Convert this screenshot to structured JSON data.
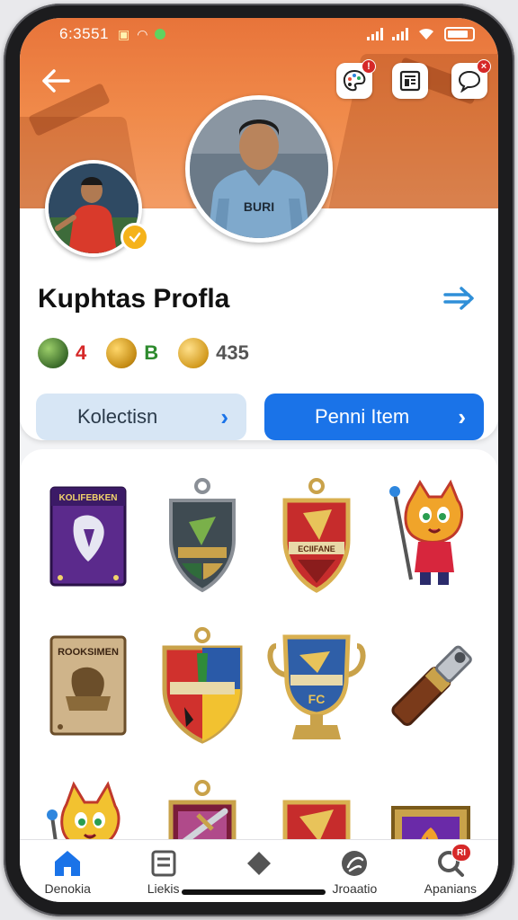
{
  "status_bar": {
    "time": "6:3551"
  },
  "profile": {
    "name": "Kuphtas Profla",
    "stats": [
      {
        "icon": "green-coin-icon",
        "value": "4",
        "color": "#d62828"
      },
      {
        "icon": "gold-coin-icon",
        "value": "B",
        "color": "#2e8b2e"
      },
      {
        "icon": "gold-ball-icon",
        "value": "435",
        "color": "#555555"
      }
    ],
    "main_jersey_text": "BURI",
    "notification_badge": "!",
    "chat_badge": "×",
    "buttons": {
      "collection_label": "Kolectisn",
      "primary_label": "Penni Item"
    }
  },
  "items": [
    {
      "name": "purple-card-pack",
      "label": "KOLIFEBKEN"
    },
    {
      "name": "dark-shield-badge",
      "label": ""
    },
    {
      "name": "red-shield-badge",
      "label": "ECIIFANE"
    },
    {
      "name": "cat-mascot",
      "label": ""
    },
    {
      "name": "brown-card-pack",
      "label": "ROOKSIMEN"
    },
    {
      "name": "striped-shield",
      "label": ""
    },
    {
      "name": "blue-trophy",
      "label": "FC"
    },
    {
      "name": "whistle",
      "label": ""
    },
    {
      "name": "cat-mascot-2",
      "label": ""
    },
    {
      "name": "sword-shield",
      "label": ""
    },
    {
      "name": "red-badge",
      "label": ""
    },
    {
      "name": "framed-card",
      "label": ""
    }
  ],
  "bottom_nav": [
    {
      "label": "Denokia",
      "icon": "home-icon",
      "active": true
    },
    {
      "label": "Liekis",
      "icon": "list-icon",
      "active": false
    },
    {
      "label": "",
      "icon": "diamond-icon",
      "active": false
    },
    {
      "label": "Jroaatio",
      "icon": "swirl-icon",
      "active": false
    },
    {
      "label": "Apanians",
      "icon": "search-badge-icon",
      "active": false,
      "badge": "RI"
    }
  ],
  "colors": {
    "accent": "#1a73e8",
    "banner": "#f08a4a"
  }
}
